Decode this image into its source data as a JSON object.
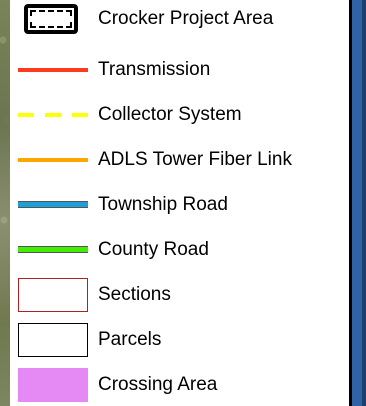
{
  "legend": {
    "items": [
      {
        "key": "project_area",
        "label": "Crocker Project Area",
        "symbol": "boundary-box",
        "color": "#000000"
      },
      {
        "key": "transmission",
        "label": "Transmission",
        "symbol": "solid-line",
        "color": "#ff3b1f"
      },
      {
        "key": "collector",
        "label": "Collector System",
        "symbol": "dashed-line",
        "color": "#ffff00"
      },
      {
        "key": "fiber",
        "label": "ADLS Tower Fiber Link",
        "symbol": "solid-line",
        "color": "#ffa500"
      },
      {
        "key": "township_road",
        "label": "Township Road",
        "symbol": "road-line",
        "color": "#1e9fd8"
      },
      {
        "key": "county_road",
        "label": "County Road",
        "symbol": "road-line",
        "color": "#44ee00"
      },
      {
        "key": "sections",
        "label": "Sections",
        "symbol": "outline-box",
        "color": "#b02020"
      },
      {
        "key": "parcels",
        "label": "Parcels",
        "symbol": "outline-box",
        "color": "#000000"
      },
      {
        "key": "crossing_area",
        "label": "Crossing Area",
        "symbol": "filled-box",
        "color": "#e58af5"
      }
    ]
  }
}
